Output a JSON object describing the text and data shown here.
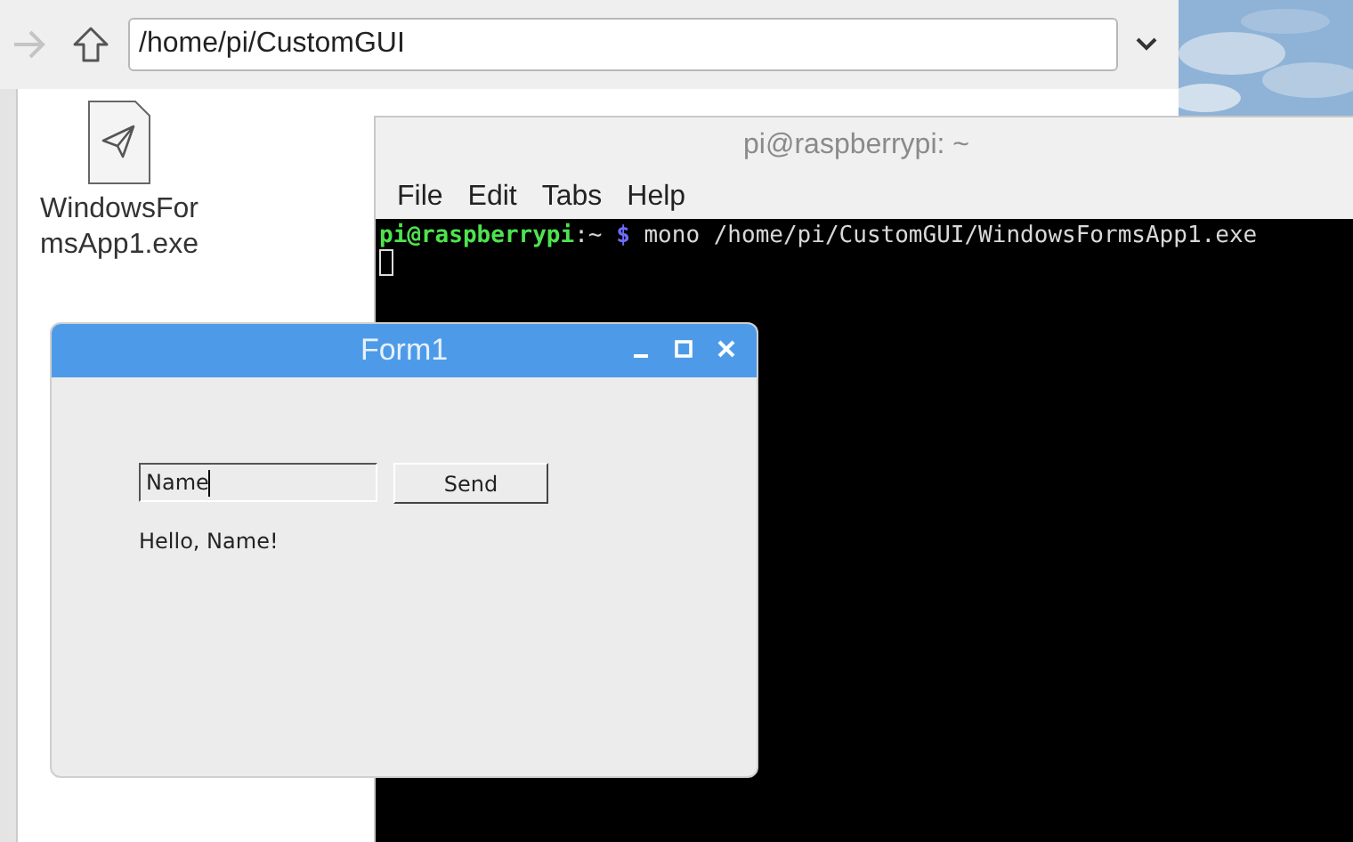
{
  "file_manager": {
    "address": "/home/pi/CustomGUI",
    "files": [
      {
        "label_lines": [
          "WindowsFor",
          "msApp1.exe"
        ]
      }
    ]
  },
  "terminal": {
    "title": "pi@raspberrypi: ~",
    "menu": [
      "File",
      "Edit",
      "Tabs",
      "Help"
    ],
    "prompt": [
      {
        "kind": "user",
        "text": "pi@raspberrypi"
      },
      {
        "kind": "path",
        "text": ":~"
      },
      {
        "kind": "symbol",
        "text": "$"
      },
      {
        "kind": "command",
        "text": "mono /home/pi/CustomGUI/WindowsFormsApp1.exe"
      }
    ]
  },
  "form": {
    "title": "Form1",
    "textbox": {
      "value": "Name"
    },
    "button": "Send",
    "label": "Hello, Name!"
  }
}
